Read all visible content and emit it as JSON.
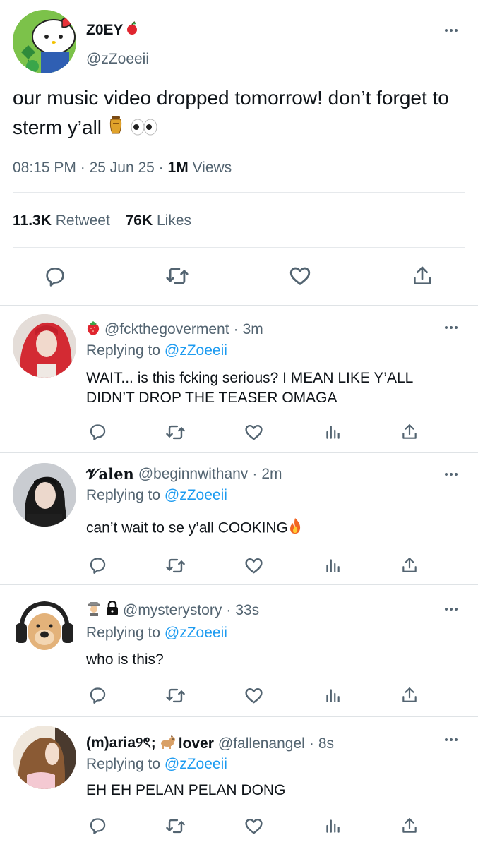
{
  "main_tweet": {
    "author_name": "Z0EY",
    "author_name_emoji": "apple-emoji",
    "author_handle": "@zZoeeii",
    "text": "our music video dropped tomorrow! don’t forget to sterm y’all",
    "text_emojis": [
      "urn-emoji",
      "eyes-emoji"
    ],
    "time": "08:15 PM",
    "date": "25 Jun 25",
    "views_count": "1M",
    "views_label": "Views",
    "retweet_count": "11.3K",
    "retweet_label": "Retweet",
    "likes_count": "76K",
    "likes_label": "Likes",
    "sep": "·"
  },
  "replies": [
    {
      "prefix_emojis": [
        "strawberry-emoji"
      ],
      "display_name": "",
      "handle": "@fckthegoverment",
      "time": "3m",
      "replying_prefix": "Replying to",
      "replying_to": "@zZoeeii",
      "text": "WAIT... is this fcking serious? I MEAN LIKE Y’ALL DIDN’T DROP THE TEASER OMAGA"
    },
    {
      "prefix_emojis": [],
      "display_name": "𝓥alen",
      "handle": "@beginnwithanv",
      "time": "2m",
      "replying_prefix": "Replying to",
      "replying_to": "@zZoeeii",
      "text": "can’t wait to se y’all COOKING"
    },
    {
      "prefix_emojis": [
        "detective-emoji",
        "lock-emoji"
      ],
      "display_name": "",
      "handle": "@mysterystory",
      "time": "33s",
      "replying_prefix": "Replying to",
      "replying_to": "@zZoeeii",
      "text": "who is this?"
    },
    {
      "prefix_emojis": [],
      "display_name_part1": "(m)aria୨ৎ;",
      "display_name_part2": "lover",
      "handle": "@fallenangel",
      "time": "8s",
      "replying_prefix": "Replying to",
      "replying_to": "@zZoeeii",
      "text": "EH EH PELAN PELAN DONG"
    }
  ],
  "colors": {
    "text": "#0f1419",
    "secondary": "#536471",
    "link": "#1d9bf0",
    "divider": "#e6e9ec"
  }
}
